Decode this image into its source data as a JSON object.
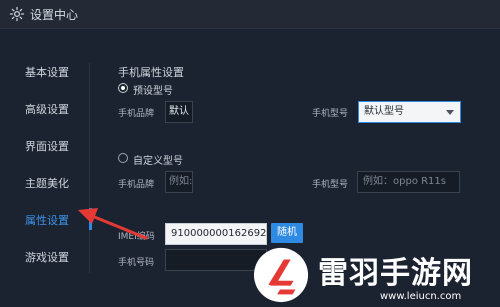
{
  "window": {
    "title": "设置中心",
    "title_icon": "gear-icon"
  },
  "sidebar": {
    "items": [
      {
        "label": "基本设置",
        "active": false
      },
      {
        "label": "高级设置",
        "active": false
      },
      {
        "label": "界面设置",
        "active": false
      },
      {
        "label": "主题美化",
        "active": false
      },
      {
        "label": "属性设置",
        "active": true
      },
      {
        "label": "游戏设置",
        "active": false
      }
    ]
  },
  "content": {
    "section_title": "手机属性设置",
    "preset": {
      "radio_label": "预设型号",
      "checked": true,
      "brand_label": "手机品牌",
      "brand_value": "默认",
      "model_label": "手机型号",
      "model_value": "默认型号"
    },
    "custom": {
      "radio_label": "自定义型号",
      "checked": false,
      "brand_label": "手机品牌",
      "brand_placeholder": "例如:",
      "model_label": "手机型号",
      "model_placeholder": "例如：oppo R11s"
    },
    "imei": {
      "label": "IMEI编码",
      "value": "910000000162692",
      "random_button": "随机"
    },
    "phone": {
      "label": "手机号码",
      "value": ""
    }
  },
  "watermark": {
    "text": "雷羽手游网",
    "url": "www.leiucn.com"
  },
  "colors": {
    "accent": "#2f8ae3",
    "arrow": "#e53935",
    "background": "#1c2330"
  }
}
